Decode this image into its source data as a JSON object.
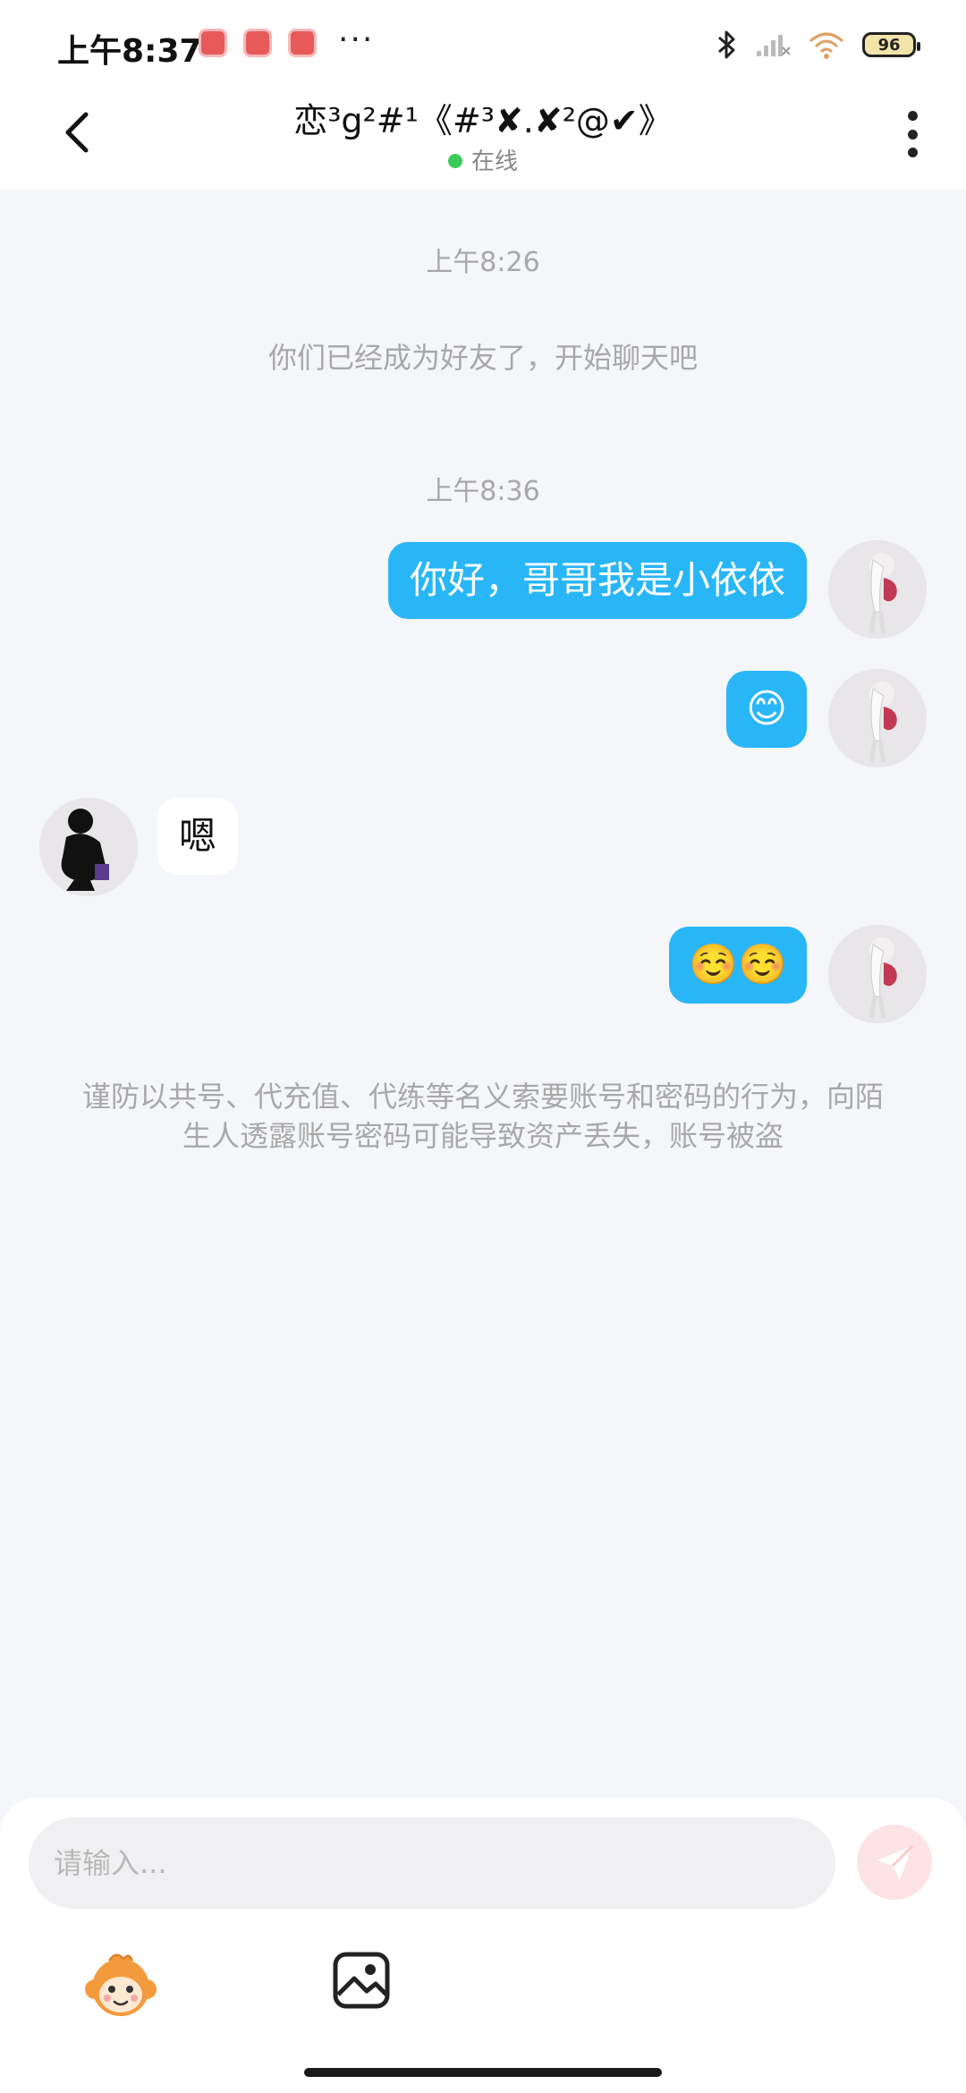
{
  "status_bar": {
    "time": "上午8:37",
    "battery": "96",
    "more_dots": "···"
  },
  "header": {
    "contact_name": "恋³g²#¹《#³✘.✘²@✔》",
    "status": "在线"
  },
  "chat": {
    "timestamp_1": "上午8:26",
    "system_friend": "你们已经成为好友了，开始聊天吧",
    "timestamp_2": "上午8:36",
    "messages": [
      {
        "side": "out",
        "text": "你好，哥哥我是小依依"
      },
      {
        "side": "out",
        "text": "😊"
      },
      {
        "side": "in",
        "text": "嗯"
      },
      {
        "side": "out",
        "text": "☺️☺️"
      }
    ],
    "warning": "谨防以共号、代充值、代练等名义索要账号和密码的行为，向陌生人透露账号密码可能导致资产丢失，账号被盗"
  },
  "composer": {
    "placeholder": "请输入..."
  },
  "icons": {
    "back": "chevron-left-icon",
    "more": "more-vertical-icon",
    "send": "paper-plane-icon",
    "sticker": "monkey-sticker-icon",
    "image": "image-icon"
  },
  "colors": {
    "outgoing_bubble": "#29b6f6",
    "online_dot": "#3ccb5a",
    "send_button": "#fde3e3"
  }
}
